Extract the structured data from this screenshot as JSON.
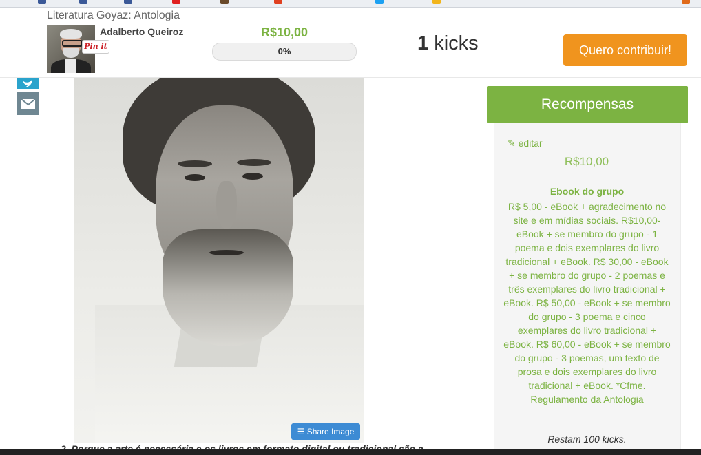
{
  "project": {
    "title": "Literatura Goyaz: Antologia",
    "creator_name": "Adalberto Queiroz",
    "pin_label": "Pin it",
    "amount": "R$10,00",
    "progress_text": "0%",
    "progress_fraction": 0,
    "kicks_count": "1",
    "kicks_label": "kicks",
    "contribute_label": "Quero contribuir!"
  },
  "share": {
    "icons": [
      "twitter-icon",
      "mail-icon"
    ],
    "image_button_label": "Share Image"
  },
  "content": {
    "truncated_text": "2.  Porque a arte é necessária e os livros em formato digital ou tradicional são a"
  },
  "rewards": {
    "header": "Recompensas",
    "edit_label": "editar",
    "amount": "R$10,00",
    "title": "Ebook do grupo",
    "description": "R$ 5,00 - eBook + agradecimento no site e em mídias sociais. R$10,00- eBook + se membro do grupo - 1 poema e dois exemplares do livro tradicional + eBook. R$ 30,00 - eBook + se membro do grupo - 2 poemas e três exemplares do livro tradicional + eBook. R$ 50,00 - eBook + se membro do grupo - 3 poema e cinco exemplares do livro tradicional + eBook. R$ 60,00 - eBook + se membro do grupo - 3 poemas, um texto de prosa e dois exemplares do livro tradicional + eBook. *Cfme. Regulamento da Antologia",
    "remaining": "Restam 100 kicks."
  },
  "colors": {
    "accent_green": "#7cb342",
    "contribute_orange": "#f0941e",
    "twitter_blue": "#2aa3cc",
    "share_image_blue": "#3d8bd4"
  }
}
